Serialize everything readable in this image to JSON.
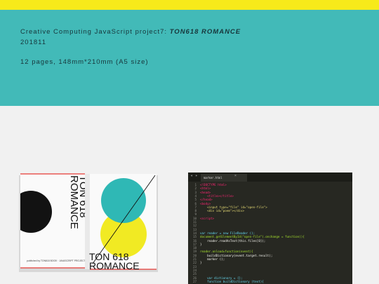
{
  "hero": {
    "title_prefix": "Creative Computing JavaScript project7: ",
    "title_emphasis": "TON618 ROMANCE",
    "date": "201811",
    "spec": "12 pages, 148mm*210mm (A5 size)"
  },
  "book": {
    "title_line1": "TON 618",
    "title_line2": "ROMANCE",
    "spine_title_line1": "TON 618",
    "spine_title_line2": "ROMANCE",
    "colophon": "published by TON618 BOOK · JAVASCRIPT PROJECT 7 2018"
  },
  "editor": {
    "tab_label": "marker.html",
    "nav_arrows": "◂ ▸",
    "close_glyph": "×",
    "lines": [
      {
        "n": "1",
        "t": "<!DOCTYPE html>",
        "c": "#f92672"
      },
      {
        "n": "2",
        "t": "<html>",
        "c": "#f92672"
      },
      {
        "n": "3",
        "t": "<head>",
        "c": "#f92672"
      },
      {
        "n": "4",
        "t": "    <title></title>",
        "c": "#f92672"
      },
      {
        "n": "5",
        "t": "</head>",
        "c": "#f92672"
      },
      {
        "n": "6",
        "t": "<body>",
        "c": "#f92672"
      },
      {
        "n": "7",
        "t": "    <input type=\"file\" id=\"open-file\">",
        "c": "#e6db74"
      },
      {
        "n": "8",
        "t": "    <div id=\"poem\"></div>",
        "c": "#e6db74"
      },
      {
        "n": "9",
        "t": "",
        "c": "#f8f8f2"
      },
      {
        "n": "10",
        "t": "<script>",
        "c": "#f92672"
      },
      {
        "n": "11",
        "t": "",
        "c": "#f8f8f2"
      },
      {
        "n": "12",
        "t": "",
        "c": "#f8f8f2"
      },
      {
        "n": "13",
        "t": "",
        "c": "#f8f8f2"
      },
      {
        "n": "14",
        "t": "var reader = new FileReader ();",
        "c": "#66d9ef"
      },
      {
        "n": "15",
        "t": "document.getElementById(\"open-file\").onchange = function(){",
        "c": "#a6e22e"
      },
      {
        "n": "16",
        "t": "    reader.readAsText(this.files[0]);",
        "c": "#f8f8f2"
      },
      {
        "n": "17",
        "t": "}",
        "c": "#f8f8f2"
      },
      {
        "n": "18",
        "t": "",
        "c": "#f8f8f2"
      },
      {
        "n": "19",
        "t": "reader.onload=function(event){",
        "c": "#a6e22e"
      },
      {
        "n": "20",
        "t": "    buildDictionary(event.target.result);",
        "c": "#f8f8f2"
      },
      {
        "n": "21",
        "t": "    marker ();",
        "c": "#f8f8f2"
      },
      {
        "n": "22",
        "t": "}",
        "c": "#f8f8f2"
      },
      {
        "n": "23",
        "t": "",
        "c": "#f8f8f2"
      },
      {
        "n": "24",
        "t": "",
        "c": "#f8f8f2"
      },
      {
        "n": "25",
        "t": "",
        "c": "#f8f8f2"
      },
      {
        "n": "26",
        "t": "    var dictionary = {};",
        "c": "#66d9ef"
      },
      {
        "n": "27",
        "t": "    function buildDictionary (text){",
        "c": "#66d9ef"
      }
    ]
  },
  "colors": {
    "accent_yellow": "#f7ea1a",
    "hero_teal": "#42bab8",
    "book_teal": "#2fb8b5",
    "book_yellow": "#f1ea23",
    "editor_bg": "#272822"
  }
}
